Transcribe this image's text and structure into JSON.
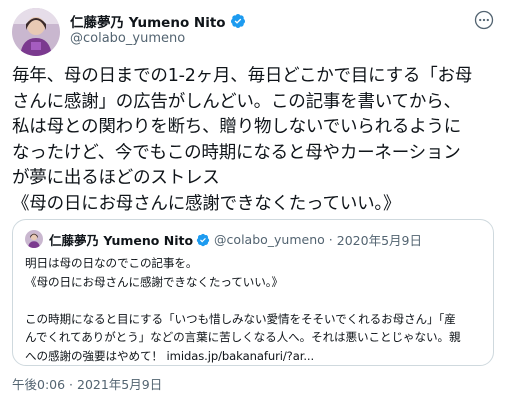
{
  "tweet": {
    "display_name": "仁藤夢乃 Yumeno Nito",
    "handle": "@colabo_yumeno",
    "body_lines": [
      "毎年、母の日までの1-2ヶ月、毎日どこかで目にする「お母",
      "さんに感謝」の広告がしんどい。この記事を書いてから、",
      "私は母との関わりを断ち、贈り物しないでいられるように",
      "なったけど、今でもこの時期になると母やカーネーション",
      "が夢に出るほどのストレス",
      "《母の日にお母さんに感謝できなくたっていい。》"
    ],
    "timestamp": "午後0:06 · 2021年5月9日",
    "quoted": {
      "display_name": "仁藤夢乃 Yumeno Nito",
      "handle": "@colabo_yumeno",
      "separator": "·",
      "date": "2020年5月9日",
      "lines": [
        "明日は母の日なのでこの記事を。",
        "《母の日にお母さんに感謝できなくたっていい。》",
        "",
        "この時期になると目にする「いつも惜しみない愛情をそそいでくれるお母さん」「産",
        "んでくれてありがとう」などの言葉に苦しくなる人へ。それは悪いことじゃない。親",
        "への感謝の強要はやめて！ imidas.jp/bakanafuri/?ar..."
      ]
    }
  },
  "icons": {
    "verified": "verified-badge-icon",
    "more": "more-options-icon"
  },
  "colors": {
    "verified_blue": "#1d9bf0",
    "secondary_text": "#536471",
    "border": "#cfd9de"
  }
}
